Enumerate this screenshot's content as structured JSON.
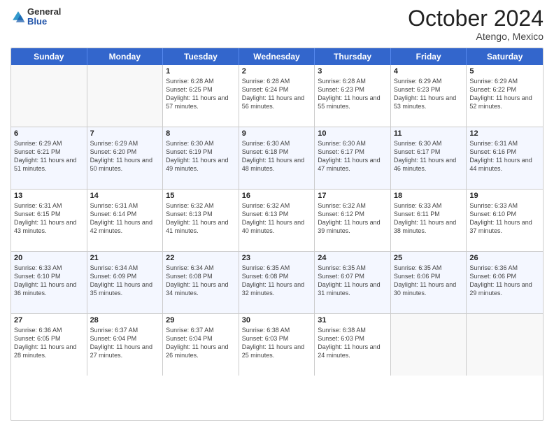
{
  "header": {
    "logo": {
      "general": "General",
      "blue": "Blue"
    },
    "title": "October 2024",
    "location": "Atengo, Mexico"
  },
  "calendar": {
    "days_of_week": [
      "Sunday",
      "Monday",
      "Tuesday",
      "Wednesday",
      "Thursday",
      "Friday",
      "Saturday"
    ],
    "rows": [
      [
        {
          "day": "",
          "sunrise": "",
          "sunset": "",
          "daylight": "",
          "empty": true
        },
        {
          "day": "",
          "sunrise": "",
          "sunset": "",
          "daylight": "",
          "empty": true
        },
        {
          "day": "1",
          "sunrise": "Sunrise: 6:28 AM",
          "sunset": "Sunset: 6:25 PM",
          "daylight": "Daylight: 11 hours and 57 minutes."
        },
        {
          "day": "2",
          "sunrise": "Sunrise: 6:28 AM",
          "sunset": "Sunset: 6:24 PM",
          "daylight": "Daylight: 11 hours and 56 minutes."
        },
        {
          "day": "3",
          "sunrise": "Sunrise: 6:28 AM",
          "sunset": "Sunset: 6:23 PM",
          "daylight": "Daylight: 11 hours and 55 minutes."
        },
        {
          "day": "4",
          "sunrise": "Sunrise: 6:29 AM",
          "sunset": "Sunset: 6:23 PM",
          "daylight": "Daylight: 11 hours and 53 minutes."
        },
        {
          "day": "5",
          "sunrise": "Sunrise: 6:29 AM",
          "sunset": "Sunset: 6:22 PM",
          "daylight": "Daylight: 11 hours and 52 minutes."
        }
      ],
      [
        {
          "day": "6",
          "sunrise": "Sunrise: 6:29 AM",
          "sunset": "Sunset: 6:21 PM",
          "daylight": "Daylight: 11 hours and 51 minutes."
        },
        {
          "day": "7",
          "sunrise": "Sunrise: 6:29 AM",
          "sunset": "Sunset: 6:20 PM",
          "daylight": "Daylight: 11 hours and 50 minutes."
        },
        {
          "day": "8",
          "sunrise": "Sunrise: 6:30 AM",
          "sunset": "Sunset: 6:19 PM",
          "daylight": "Daylight: 11 hours and 49 minutes."
        },
        {
          "day": "9",
          "sunrise": "Sunrise: 6:30 AM",
          "sunset": "Sunset: 6:18 PM",
          "daylight": "Daylight: 11 hours and 48 minutes."
        },
        {
          "day": "10",
          "sunrise": "Sunrise: 6:30 AM",
          "sunset": "Sunset: 6:17 PM",
          "daylight": "Daylight: 11 hours and 47 minutes."
        },
        {
          "day": "11",
          "sunrise": "Sunrise: 6:30 AM",
          "sunset": "Sunset: 6:17 PM",
          "daylight": "Daylight: 11 hours and 46 minutes."
        },
        {
          "day": "12",
          "sunrise": "Sunrise: 6:31 AM",
          "sunset": "Sunset: 6:16 PM",
          "daylight": "Daylight: 11 hours and 44 minutes."
        }
      ],
      [
        {
          "day": "13",
          "sunrise": "Sunrise: 6:31 AM",
          "sunset": "Sunset: 6:15 PM",
          "daylight": "Daylight: 11 hours and 43 minutes."
        },
        {
          "day": "14",
          "sunrise": "Sunrise: 6:31 AM",
          "sunset": "Sunset: 6:14 PM",
          "daylight": "Daylight: 11 hours and 42 minutes."
        },
        {
          "day": "15",
          "sunrise": "Sunrise: 6:32 AM",
          "sunset": "Sunset: 6:13 PM",
          "daylight": "Daylight: 11 hours and 41 minutes."
        },
        {
          "day": "16",
          "sunrise": "Sunrise: 6:32 AM",
          "sunset": "Sunset: 6:13 PM",
          "daylight": "Daylight: 11 hours and 40 minutes."
        },
        {
          "day": "17",
          "sunrise": "Sunrise: 6:32 AM",
          "sunset": "Sunset: 6:12 PM",
          "daylight": "Daylight: 11 hours and 39 minutes."
        },
        {
          "day": "18",
          "sunrise": "Sunrise: 6:33 AM",
          "sunset": "Sunset: 6:11 PM",
          "daylight": "Daylight: 11 hours and 38 minutes."
        },
        {
          "day": "19",
          "sunrise": "Sunrise: 6:33 AM",
          "sunset": "Sunset: 6:10 PM",
          "daylight": "Daylight: 11 hours and 37 minutes."
        }
      ],
      [
        {
          "day": "20",
          "sunrise": "Sunrise: 6:33 AM",
          "sunset": "Sunset: 6:10 PM",
          "daylight": "Daylight: 11 hours and 36 minutes."
        },
        {
          "day": "21",
          "sunrise": "Sunrise: 6:34 AM",
          "sunset": "Sunset: 6:09 PM",
          "daylight": "Daylight: 11 hours and 35 minutes."
        },
        {
          "day": "22",
          "sunrise": "Sunrise: 6:34 AM",
          "sunset": "Sunset: 6:08 PM",
          "daylight": "Daylight: 11 hours and 34 minutes."
        },
        {
          "day": "23",
          "sunrise": "Sunrise: 6:35 AM",
          "sunset": "Sunset: 6:08 PM",
          "daylight": "Daylight: 11 hours and 32 minutes."
        },
        {
          "day": "24",
          "sunrise": "Sunrise: 6:35 AM",
          "sunset": "Sunset: 6:07 PM",
          "daylight": "Daylight: 11 hours and 31 minutes."
        },
        {
          "day": "25",
          "sunrise": "Sunrise: 6:35 AM",
          "sunset": "Sunset: 6:06 PM",
          "daylight": "Daylight: 11 hours and 30 minutes."
        },
        {
          "day": "26",
          "sunrise": "Sunrise: 6:36 AM",
          "sunset": "Sunset: 6:06 PM",
          "daylight": "Daylight: 11 hours and 29 minutes."
        }
      ],
      [
        {
          "day": "27",
          "sunrise": "Sunrise: 6:36 AM",
          "sunset": "Sunset: 6:05 PM",
          "daylight": "Daylight: 11 hours and 28 minutes."
        },
        {
          "day": "28",
          "sunrise": "Sunrise: 6:37 AM",
          "sunset": "Sunset: 6:04 PM",
          "daylight": "Daylight: 11 hours and 27 minutes."
        },
        {
          "day": "29",
          "sunrise": "Sunrise: 6:37 AM",
          "sunset": "Sunset: 6:04 PM",
          "daylight": "Daylight: 11 hours and 26 minutes."
        },
        {
          "day": "30",
          "sunrise": "Sunrise: 6:38 AM",
          "sunset": "Sunset: 6:03 PM",
          "daylight": "Daylight: 11 hours and 25 minutes."
        },
        {
          "day": "31",
          "sunrise": "Sunrise: 6:38 AM",
          "sunset": "Sunset: 6:03 PM",
          "daylight": "Daylight: 11 hours and 24 minutes."
        },
        {
          "day": "",
          "sunrise": "",
          "sunset": "",
          "daylight": "",
          "empty": true
        },
        {
          "day": "",
          "sunrise": "",
          "sunset": "",
          "daylight": "",
          "empty": true
        }
      ]
    ]
  }
}
